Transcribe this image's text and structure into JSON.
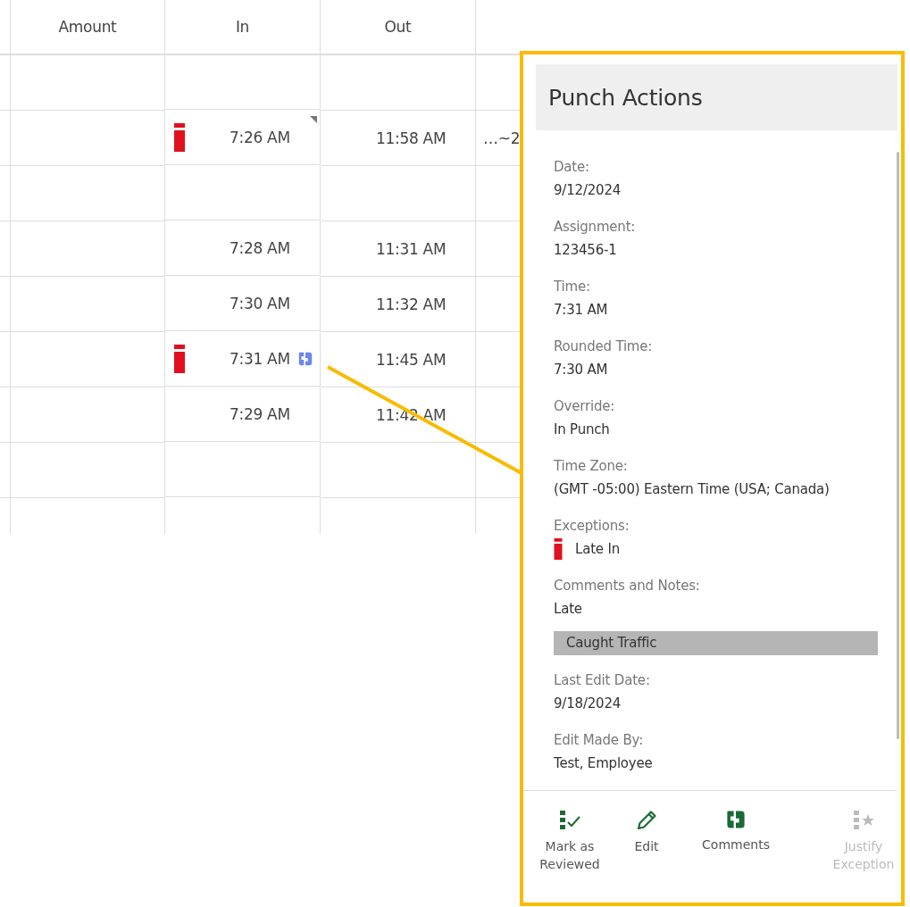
{
  "table": {
    "columns": [
      "Amount",
      "In",
      "Out"
    ],
    "rows": [
      {
        "exception": false,
        "in": "",
        "out": "",
        "edited": false,
        "comment": false
      },
      {
        "exception": true,
        "in": "7:26 AM",
        "out": "11:58 AM",
        "edited": true,
        "comment": false,
        "column_4": "…~2"
      },
      {
        "exception": false,
        "in": "",
        "out": "",
        "edited": false,
        "comment": false
      },
      {
        "exception": false,
        "in": "7:28 AM",
        "out": "11:31 AM",
        "edited": false,
        "comment": false
      },
      {
        "exception": false,
        "in": "7:30 AM",
        "out": "11:32 AM",
        "edited": false,
        "comment": false
      },
      {
        "exception": true,
        "in": "7:31 AM",
        "out": "11:45 AM",
        "edited": false,
        "comment": true
      },
      {
        "exception": false,
        "in": "7:29 AM",
        "out": "11:42 AM",
        "edited": false,
        "comment": false
      },
      {
        "exception": false,
        "in": "",
        "out": "",
        "edited": false,
        "comment": false
      },
      {
        "exception": false,
        "in": "",
        "out": "",
        "edited": false,
        "comment": false
      }
    ]
  },
  "panel": {
    "title": "Punch Actions",
    "fields": [
      {
        "kind": "text",
        "label": "Date:",
        "value": "9/12/2024"
      },
      {
        "kind": "text",
        "label": "Assignment:",
        "value": "123456-1"
      },
      {
        "kind": "text",
        "label": "Time:",
        "value": "7:31 AM"
      },
      {
        "kind": "text",
        "label": "Rounded Time:",
        "value": "7:30 AM"
      },
      {
        "kind": "text",
        "label": "Override:",
        "value": "In Punch"
      },
      {
        "kind": "text",
        "label": "Time Zone:",
        "value": "(GMT -05:00) Eastern Time (USA; Canada)"
      },
      {
        "kind": "exception",
        "label": "Exceptions:",
        "value": "Late In"
      },
      {
        "kind": "comment",
        "label": "Comments and Notes:",
        "value": "Late",
        "note": "Caught Traffic"
      },
      {
        "kind": "text",
        "label": "Last Edit Date:",
        "value": "9/18/2024"
      },
      {
        "kind": "text",
        "label": "Edit Made By:",
        "value": "Test, Employee"
      }
    ],
    "actions": [
      {
        "kind": "review",
        "label": "Mark as Reviewed",
        "disabled": false
      },
      {
        "kind": "edit",
        "label": "Edit",
        "disabled": false
      },
      {
        "kind": "comments",
        "label": "Comments",
        "disabled": false
      },
      {
        "kind": "justify",
        "label": "Justify Exception",
        "disabled": true
      }
    ]
  }
}
